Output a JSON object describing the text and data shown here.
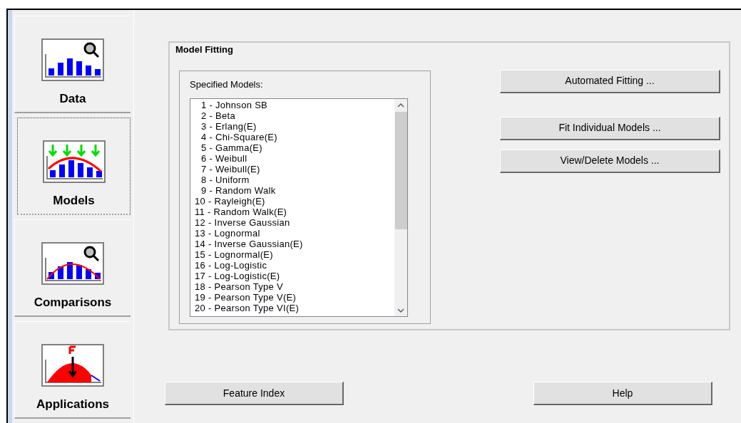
{
  "sidebar": {
    "items": [
      {
        "label": "Data",
        "kind": "data",
        "selected": false
      },
      {
        "label": "Models",
        "kind": "models",
        "selected": true
      },
      {
        "label": "Comparisons",
        "kind": "comparisons",
        "selected": false
      },
      {
        "label": "Applications",
        "kind": "applications",
        "selected": false
      }
    ]
  },
  "model_fitting": {
    "title": "Model Fitting",
    "specified_models": {
      "label": "Specified Models:",
      "items": [
        "1 - Johnson SB",
        "2 - Beta",
        "3 - Erlang(E)",
        "4 - Chi-Square(E)",
        "5 - Gamma(E)",
        "6 - Weibull",
        "7 - Weibull(E)",
        "8 - Uniform",
        "9 - Random Walk",
        "10 - Rayleigh(E)",
        "11 - Random Walk(E)",
        "12 - Inverse Gaussian",
        "13 - Lognormal",
        "14 - Inverse Gaussian(E)",
        "15 - Lognormal(E)",
        "16 - Log-Logistic",
        "17 - Log-Logistic(E)",
        "18 - Pearson Type V",
        "19 - Pearson Type V(E)",
        "20 - Pearson Type VI(E)"
      ]
    },
    "buttons": [
      "Automated Fitting ...",
      "Fit Individual Models ...",
      "View/Delete Models ..."
    ]
  },
  "bottom_buttons": [
    "Feature Index",
    "Help"
  ]
}
